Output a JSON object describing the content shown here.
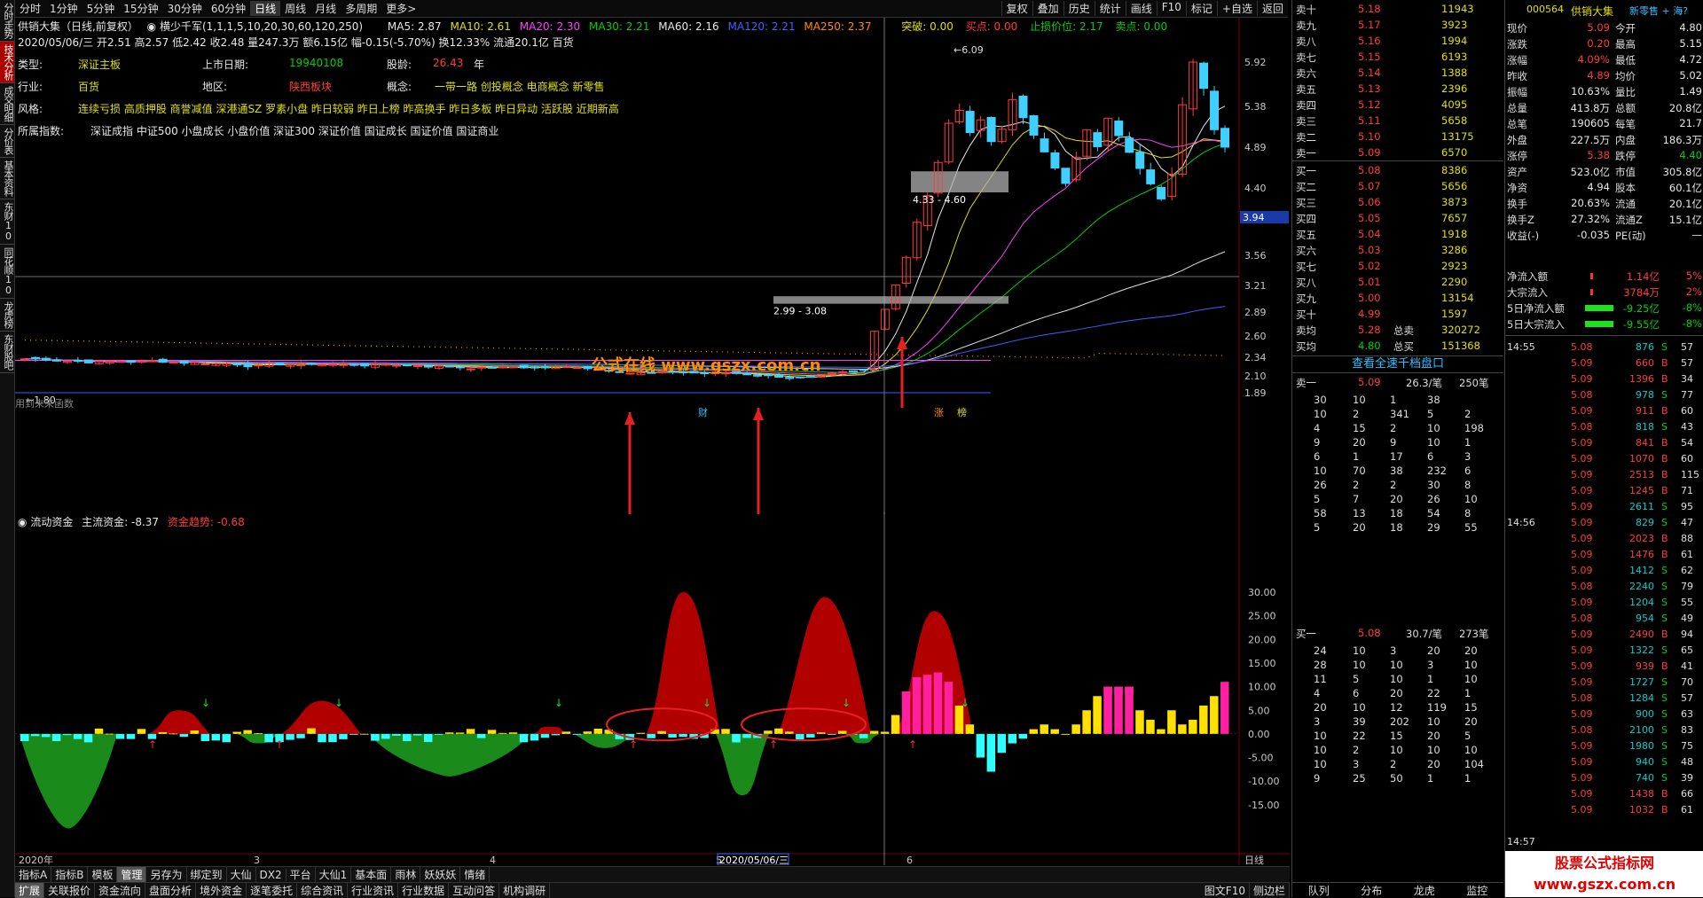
{
  "left_tabs": [
    "分时走势",
    "技术分析",
    "成交明细",
    "分价表",
    "基本资料",
    "东财10",
    "同花顺10",
    "龙虎榜",
    "东财股吧"
  ],
  "toolbar": {
    "periods": [
      "分时",
      "1分钟",
      "5分钟",
      "15分钟",
      "30分钟",
      "60分钟",
      "日线",
      "周线",
      "月线",
      "多周期",
      "更多>"
    ],
    "selected": "日线",
    "right": [
      "复权",
      "叠加",
      "历史",
      "统计",
      "画线",
      "F10",
      "标记",
      "+自选",
      "返回"
    ]
  },
  "title_line": {
    "stock": "供销大集（日线,前复权）",
    "indicator": "横少千军(1,1,1,5,10,20,30,60,120,250)",
    "ma5": "MA5: 2.87",
    "ma10": "MA10: 2.61",
    "ma20": "MA20: 2.30",
    "ma30": "MA30: 2.21",
    "ma60": "MA60: 2.16",
    "ma120": "MA120: 2.21",
    "ma250": "MA250: 2.37",
    "tupo": "突破: 0.00",
    "maidian": "买点: 0.00",
    "zhisun": "止损价位: 2.17",
    "maichu": "卖点: 0.00"
  },
  "ohlc_line": "2020/05/06/三 开2.51 高2.57 低2.42 收2.48 量247.3万 额6.15亿 幅-0.15(-5.70%) 换12.33% 流通20.1亿 百货",
  "info": {
    "type_label": "类型:",
    "type_value": "深证主板",
    "list_label": "上市日期:",
    "list_value": "19940108",
    "age_label": "股龄:",
    "age_value": "26.43",
    "age_unit": "年",
    "industry_label": "行业:",
    "industry_value": "百货",
    "region_label": "地区:",
    "region_value": "陕西板块",
    "concept_label": "概念:",
    "concept_value": "一带一路 创投概念 电商概念 新零售",
    "style_label": "风格:",
    "style_value": "连续亏损 高质押股 商誉减值 深港通SZ 罗素小盘 昨日较弱 昨日上榜 昨高换手 昨日多板 昨日异动 活跃股 近期新高",
    "index_label": "所属指数:",
    "index_value": "深证成指 中证500 小盘成长 小盘价值 深证300 深证价值 国证成长 国证价值 国证商业"
  },
  "main_chart": {
    "price_axis": [
      "5.92",
      "5.38",
      "4.89",
      "4.40",
      "3.56",
      "3.21",
      "2.89",
      "2.60",
      "2.34",
      "2.10",
      "1.89"
    ],
    "current_price": "3.94",
    "high_label": "6.09",
    "low_label": "1.80",
    "zone1": "4.33 - 4.60",
    "zone2": "2.99 - 3.08",
    "watermark": "公式在线 www.gszx.com.cn",
    "hint": "用到未来函数",
    "mark_cai": "财",
    "mark_zhang": "涨",
    "mark_bang": "榜"
  },
  "sub_chart": {
    "title": "流动资金",
    "main_label": "主流资金: -8.37",
    "trend_label": "资金趋势: -0.68",
    "axis": [
      "30.00",
      "25.00",
      "20.00",
      "15.00",
      "10.00",
      "5.00",
      "0.00",
      "-5.00",
      "-10.00",
      "-15.00"
    ],
    "date_labels": [
      "2020年",
      "3",
      "4",
      "5",
      "2020/05/06/三",
      "6"
    ],
    "period": "日线"
  },
  "bottom_bar1": [
    "指标A",
    "指标B",
    "模板",
    "管理",
    "另存为",
    "绑定到",
    "大仙",
    "DX2",
    "平台",
    "大仙1",
    "基本面",
    "雨林",
    "妖妖妖",
    "情绪"
  ],
  "bottom_bar1_selected": "管理",
  "bottom_bar2": [
    "扩展",
    "关联报价",
    "资金流向",
    "盘面分析",
    "境外资金",
    "逐笔委托",
    "综合资讯",
    "行业资讯",
    "行业数据",
    "互动问答",
    "机构调研"
  ],
  "bottom_bar2_selected": "扩展",
  "bottom_right": [
    "图文F10",
    "侧边栏"
  ],
  "orderbook": {
    "sell": [
      [
        "卖十",
        "5.18",
        "11943"
      ],
      [
        "卖九",
        "5.17",
        "3923"
      ],
      [
        "卖八",
        "5.16",
        "1994"
      ],
      [
        "卖七",
        "5.15",
        "6193"
      ],
      [
        "卖六",
        "5.14",
        "1388"
      ],
      [
        "卖五",
        "5.13",
        "2396"
      ],
      [
        "卖四",
        "5.12",
        "4095"
      ],
      [
        "卖三",
        "5.11",
        "5658"
      ],
      [
        "卖二",
        "5.10",
        "13175"
      ],
      [
        "卖一",
        "5.09",
        "6570"
      ]
    ],
    "buy": [
      [
        "买一",
        "5.08",
        "8386"
      ],
      [
        "买二",
        "5.07",
        "5656"
      ],
      [
        "买三",
        "5.06",
        "3873"
      ],
      [
        "买四",
        "5.05",
        "7657"
      ],
      [
        "买五",
        "5.04",
        "1918"
      ],
      [
        "买六",
        "5.03",
        "3286"
      ],
      [
        "买七",
        "5.02",
        "2923"
      ],
      [
        "买八",
        "5.01",
        "2290"
      ],
      [
        "买九",
        "5.00",
        "13154"
      ],
      [
        "买十",
        "4.99",
        "1597"
      ]
    ],
    "sell_avg": [
      "卖均",
      "5.28",
      "总卖",
      "320272"
    ],
    "buy_avg": [
      "买均",
      "4.80",
      "总买",
      "151368"
    ],
    "all_link": "查看全速千档盘口",
    "sell1_head": [
      "卖一",
      "5.09",
      "26.3/笔",
      "250笔"
    ],
    "sell1_grid": [
      [
        "30",
        "10",
        "1",
        "38"
      ],
      [
        "10",
        "2",
        "341",
        "5",
        "2"
      ],
      [
        "4",
        "15",
        "2",
        "10",
        "198"
      ],
      [
        "9",
        "20",
        "9",
        "10",
        "1"
      ],
      [
        "6",
        "1",
        "17",
        "6",
        "3"
      ],
      [
        "10",
        "70",
        "38",
        "232",
        "6"
      ],
      [
        "26",
        "2",
        "2",
        "30",
        "8"
      ],
      [
        "5",
        "7",
        "20",
        "26",
        "10"
      ],
      [
        "58",
        "13",
        "18",
        "54",
        "8"
      ],
      [
        "5",
        "20",
        "18",
        "29",
        "55"
      ]
    ],
    "buy1_head": [
      "买一",
      "5.08",
      "30.7/笔",
      "273笔"
    ],
    "buy1_grid": [
      [
        "24",
        "10",
        "3",
        "20",
        "20"
      ],
      [
        "28",
        "10",
        "10",
        "3",
        "10"
      ],
      [
        "11",
        "5",
        "10",
        "1",
        "10"
      ],
      [
        "4",
        "6",
        "20",
        "22",
        "1"
      ],
      [
        "20",
        "10",
        "12",
        "119",
        "15"
      ],
      [
        "3",
        "39",
        "202",
        "10",
        "20"
      ],
      [
        "10",
        "22",
        "15",
        "20",
        "5"
      ],
      [
        "10",
        "2",
        "10",
        "10",
        "10"
      ],
      [
        "10",
        "3",
        "2",
        "20",
        "104"
      ],
      [
        "9",
        "25",
        "50",
        "1",
        "1"
      ]
    ],
    "bottom_tabs": [
      "队列",
      "分布",
      "龙虎",
      "监控"
    ]
  },
  "quote": {
    "code": "000564",
    "name": "供销大集",
    "tag": "新零售 + 海?",
    "rows": [
      [
        "现价",
        "5.09",
        "今开",
        "4.80"
      ],
      [
        "涨跌",
        "0.20",
        "最高",
        "5.15"
      ],
      [
        "涨幅",
        "4.09%",
        "最低",
        "4.72"
      ],
      [
        "昨收",
        "4.89",
        "均价",
        "5.02"
      ],
      [
        "振幅",
        "10.63%",
        "量比",
        "1.49"
      ],
      [
        "总量",
        "413.8万",
        "总额",
        "20.8亿"
      ],
      [
        "总笔",
        "190605",
        "每笔",
        "21.7"
      ],
      [
        "外盘",
        "227.5万",
        "内盘",
        "186.3万"
      ],
      [
        "涨停",
        "5.38",
        "跌停",
        "4.40"
      ],
      [
        "资产",
        "523.0亿",
        "市值",
        "305.8亿"
      ],
      [
        "净资",
        "4.94",
        "股本",
        "60.1亿"
      ],
      [
        "换手",
        "20.63%",
        "流通",
        "20.1亿"
      ],
      [
        "换手Z",
        "27.32%",
        "流通Z",
        "15.1亿"
      ],
      [
        "收益(-)",
        "-0.035",
        "PE(动)",
        "—"
      ]
    ],
    "flows": [
      [
        "净流入额",
        "1.14亿",
        "5%"
      ],
      [
        "大宗流入",
        "3784万",
        "2%"
      ],
      [
        "5日净流入额",
        "-9.25亿",
        "-8%"
      ],
      [
        "5日大宗流入",
        "-9.55亿",
        "-8%"
      ]
    ],
    "ticks_time1": "14:55",
    "ticks_time2": "14:56",
    "ticks_time3": "14:57",
    "ticks": [
      [
        "5.08",
        "876",
        "S",
        "57"
      ],
      [
        "5.09",
        "660",
        "B",
        "57"
      ],
      [
        "5.09",
        "1396",
        "B",
        "34"
      ],
      [
        "5.08",
        "978",
        "S",
        "77"
      ],
      [
        "5.09",
        "911",
        "B",
        "60"
      ],
      [
        "5.08",
        "818",
        "S",
        "43"
      ],
      [
        "5.09",
        "841",
        "B",
        "54"
      ],
      [
        "5.09",
        "1070",
        "B",
        "60"
      ],
      [
        "5.09",
        "2513",
        "B",
        "115"
      ],
      [
        "5.09",
        "1245",
        "B",
        "71"
      ],
      [
        "5.09",
        "2611",
        "S",
        "95"
      ],
      [
        "5.09",
        "829",
        "S",
        "47"
      ],
      [
        "5.09",
        "2023",
        "B",
        "88"
      ],
      [
        "5.09",
        "1476",
        "B",
        "61"
      ],
      [
        "5.09",
        "1412",
        "S",
        "62"
      ],
      [
        "5.08",
        "2240",
        "S",
        "79"
      ],
      [
        "5.09",
        "1204",
        "S",
        "55"
      ],
      [
        "5.08",
        "954",
        "S",
        "49"
      ],
      [
        "5.09",
        "2490",
        "B",
        "94"
      ],
      [
        "5.09",
        "1322",
        "S",
        "65"
      ],
      [
        "5.09",
        "939",
        "B",
        "41"
      ],
      [
        "5.09",
        "1727",
        "S",
        "70"
      ],
      [
        "5.08",
        "1284",
        "S",
        "57"
      ],
      [
        "5.09",
        "900",
        "S",
        "63"
      ],
      [
        "5.08",
        "2100",
        "S",
        "83"
      ],
      [
        "5.09",
        "1980",
        "S",
        "75"
      ],
      [
        "5.09",
        "940",
        "S",
        "48"
      ],
      [
        "5.09",
        "740",
        "S",
        "39"
      ],
      [
        "5.09",
        "1438",
        "B",
        "66"
      ],
      [
        "5.09",
        "1032",
        "B",
        "61"
      ]
    ],
    "bottom": "股票公式指标网 www.gszx.com.cn"
  }
}
